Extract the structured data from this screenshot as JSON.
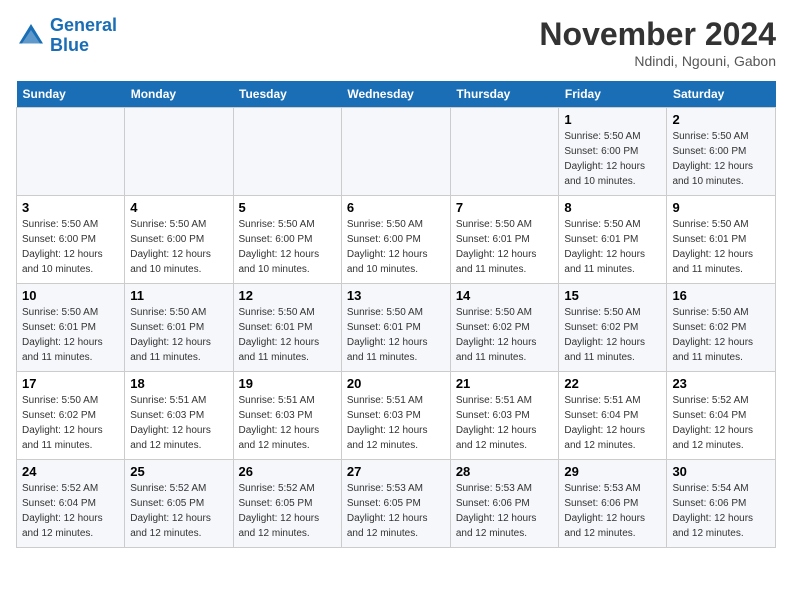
{
  "header": {
    "logo_line1": "General",
    "logo_line2": "Blue",
    "month_title": "November 2024",
    "subtitle": "Ndindi, Ngouni, Gabon"
  },
  "days_of_week": [
    "Sunday",
    "Monday",
    "Tuesday",
    "Wednesday",
    "Thursday",
    "Friday",
    "Saturday"
  ],
  "weeks": [
    [
      {
        "day": "",
        "info": ""
      },
      {
        "day": "",
        "info": ""
      },
      {
        "day": "",
        "info": ""
      },
      {
        "day": "",
        "info": ""
      },
      {
        "day": "",
        "info": ""
      },
      {
        "day": "1",
        "info": "Sunrise: 5:50 AM\nSunset: 6:00 PM\nDaylight: 12 hours\nand 10 minutes."
      },
      {
        "day": "2",
        "info": "Sunrise: 5:50 AM\nSunset: 6:00 PM\nDaylight: 12 hours\nand 10 minutes."
      }
    ],
    [
      {
        "day": "3",
        "info": "Sunrise: 5:50 AM\nSunset: 6:00 PM\nDaylight: 12 hours\nand 10 minutes."
      },
      {
        "day": "4",
        "info": "Sunrise: 5:50 AM\nSunset: 6:00 PM\nDaylight: 12 hours\nand 10 minutes."
      },
      {
        "day": "5",
        "info": "Sunrise: 5:50 AM\nSunset: 6:00 PM\nDaylight: 12 hours\nand 10 minutes."
      },
      {
        "day": "6",
        "info": "Sunrise: 5:50 AM\nSunset: 6:00 PM\nDaylight: 12 hours\nand 10 minutes."
      },
      {
        "day": "7",
        "info": "Sunrise: 5:50 AM\nSunset: 6:01 PM\nDaylight: 12 hours\nand 11 minutes."
      },
      {
        "day": "8",
        "info": "Sunrise: 5:50 AM\nSunset: 6:01 PM\nDaylight: 12 hours\nand 11 minutes."
      },
      {
        "day": "9",
        "info": "Sunrise: 5:50 AM\nSunset: 6:01 PM\nDaylight: 12 hours\nand 11 minutes."
      }
    ],
    [
      {
        "day": "10",
        "info": "Sunrise: 5:50 AM\nSunset: 6:01 PM\nDaylight: 12 hours\nand 11 minutes."
      },
      {
        "day": "11",
        "info": "Sunrise: 5:50 AM\nSunset: 6:01 PM\nDaylight: 12 hours\nand 11 minutes."
      },
      {
        "day": "12",
        "info": "Sunrise: 5:50 AM\nSunset: 6:01 PM\nDaylight: 12 hours\nand 11 minutes."
      },
      {
        "day": "13",
        "info": "Sunrise: 5:50 AM\nSunset: 6:01 PM\nDaylight: 12 hours\nand 11 minutes."
      },
      {
        "day": "14",
        "info": "Sunrise: 5:50 AM\nSunset: 6:02 PM\nDaylight: 12 hours\nand 11 minutes."
      },
      {
        "day": "15",
        "info": "Sunrise: 5:50 AM\nSunset: 6:02 PM\nDaylight: 12 hours\nand 11 minutes."
      },
      {
        "day": "16",
        "info": "Sunrise: 5:50 AM\nSunset: 6:02 PM\nDaylight: 12 hours\nand 11 minutes."
      }
    ],
    [
      {
        "day": "17",
        "info": "Sunrise: 5:50 AM\nSunset: 6:02 PM\nDaylight: 12 hours\nand 11 minutes."
      },
      {
        "day": "18",
        "info": "Sunrise: 5:51 AM\nSunset: 6:03 PM\nDaylight: 12 hours\nand 12 minutes."
      },
      {
        "day": "19",
        "info": "Sunrise: 5:51 AM\nSunset: 6:03 PM\nDaylight: 12 hours\nand 12 minutes."
      },
      {
        "day": "20",
        "info": "Sunrise: 5:51 AM\nSunset: 6:03 PM\nDaylight: 12 hours\nand 12 minutes."
      },
      {
        "day": "21",
        "info": "Sunrise: 5:51 AM\nSunset: 6:03 PM\nDaylight: 12 hours\nand 12 minutes."
      },
      {
        "day": "22",
        "info": "Sunrise: 5:51 AM\nSunset: 6:04 PM\nDaylight: 12 hours\nand 12 minutes."
      },
      {
        "day": "23",
        "info": "Sunrise: 5:52 AM\nSunset: 6:04 PM\nDaylight: 12 hours\nand 12 minutes."
      }
    ],
    [
      {
        "day": "24",
        "info": "Sunrise: 5:52 AM\nSunset: 6:04 PM\nDaylight: 12 hours\nand 12 minutes."
      },
      {
        "day": "25",
        "info": "Sunrise: 5:52 AM\nSunset: 6:05 PM\nDaylight: 12 hours\nand 12 minutes."
      },
      {
        "day": "26",
        "info": "Sunrise: 5:52 AM\nSunset: 6:05 PM\nDaylight: 12 hours\nand 12 minutes."
      },
      {
        "day": "27",
        "info": "Sunrise: 5:53 AM\nSunset: 6:05 PM\nDaylight: 12 hours\nand 12 minutes."
      },
      {
        "day": "28",
        "info": "Sunrise: 5:53 AM\nSunset: 6:06 PM\nDaylight: 12 hours\nand 12 minutes."
      },
      {
        "day": "29",
        "info": "Sunrise: 5:53 AM\nSunset: 6:06 PM\nDaylight: 12 hours\nand 12 minutes."
      },
      {
        "day": "30",
        "info": "Sunrise: 5:54 AM\nSunset: 6:06 PM\nDaylight: 12 hours\nand 12 minutes."
      }
    ]
  ]
}
